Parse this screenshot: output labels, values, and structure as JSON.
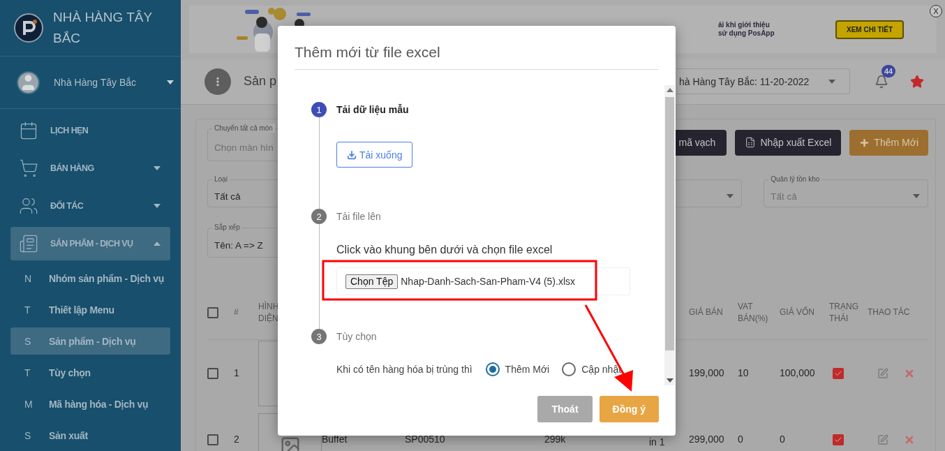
{
  "sidebar": {
    "brand": "NHÀ HÀNG TÂY BẮC",
    "user": "Nhà Hàng Tây Bắc",
    "items": [
      {
        "kind": "link",
        "label": "LỊCH HẸN",
        "selected": false
      },
      {
        "kind": "group",
        "label": "BÁN HÀNG",
        "selected": false,
        "expanded": false
      },
      {
        "kind": "group",
        "label": "ĐỐI TÁC",
        "selected": false,
        "expanded": false
      },
      {
        "kind": "group",
        "label": "SẢN PHẨM - DỊCH VỤ",
        "selected": true,
        "expanded": true,
        "children": [
          {
            "letter": "N",
            "label": "Nhóm sản phẩm - Dịch vụ",
            "selected": false
          },
          {
            "letter": "T",
            "label": "Thiết lập Menu",
            "selected": false
          },
          {
            "letter": "S",
            "label": "Sản phẩm - Dịch vụ",
            "selected": true
          },
          {
            "letter": "T",
            "label": "Tùy chọn",
            "selected": false
          },
          {
            "letter": "M",
            "label": "Mã hàng hóa - Dịch vụ",
            "selected": false
          },
          {
            "letter": "S",
            "label": "Sản xuất",
            "selected": false
          }
        ]
      }
    ]
  },
  "banner": {
    "lines": [
      "ải khi giới thiệu",
      "sử dụng PosApp"
    ],
    "button": "XEM CHI TIẾT",
    "close": "X"
  },
  "header": {
    "title": "Sản p",
    "store": "hà Hàng Tây Bắc: 11-20-2022",
    "notifications": "44"
  },
  "toolbar": {
    "buttons": [
      {
        "kind": "dark",
        "label": "mã vạch"
      },
      {
        "kind": "excel",
        "label": "Nhập xuất Excel"
      },
      {
        "kind": "add",
        "label": "Thêm Mới"
      }
    ]
  },
  "filters": {
    "move": {
      "label": "Chuyển tất cả món",
      "placeholder": "Chọn màn hìn"
    },
    "type": {
      "label": "Loại",
      "value": "Tất cả"
    },
    "stock": {
      "label": "Quản lý tồn kho",
      "placeholder": "Tất cả"
    },
    "sort": {
      "label": "Sắp xếp",
      "value": "Tên: A => Z"
    }
  },
  "table": {
    "header": {
      "checked": false,
      "number": "#",
      "image": "HÌNH DIỆN",
      "gia_ban": "GIÁ BÁN",
      "vat_ban": "VAT BÁN(%)",
      "gia_von": "GIÁ VỐN",
      "trang_thai": "TRẠNG THÁI",
      "thao_tac": "THAO TÁC"
    },
    "rows": [
      {
        "checked": false,
        "number": "1",
        "gia_ban": "199,000",
        "vat_ban": "10",
        "gia_von": "100,000",
        "trang_thai": true
      },
      {
        "checked": false,
        "number": "2",
        "column_4": "Buffet",
        "column_5": "SP00510",
        "column_6": "299k",
        "column_7": "in 1",
        "gia_ban": "299,000",
        "vat_ban": "0",
        "gia_von": "0",
        "trang_thai": true
      }
    ]
  },
  "modal": {
    "title": "Thêm mới từ file excel",
    "steps": [
      {
        "number": "1",
        "title": "Tải dữ liệu mẫu",
        "active": true,
        "kind": "download",
        "button": "Tải xuống"
      },
      {
        "number": "2",
        "title": "Tải file lên",
        "active": false,
        "kind": "upload",
        "hint": "Click vào khung bên dưới và chọn file excel",
        "choose": "Chọn Tệp",
        "file": "Nhap-Danh-Sach-San-Pham-V4 (5).xlsx"
      },
      {
        "number": "3",
        "title": "Tùy chọn",
        "active": false,
        "kind": "options",
        "question": "Khi có tên hàng hóa bị trùng thì",
        "options": [
          {
            "label": "Thêm Mới",
            "selected": true
          },
          {
            "label": "Cập nhật",
            "selected": false
          }
        ]
      }
    ],
    "buttons": [
      {
        "label": "Thoát",
        "disabled": true
      },
      {
        "label": "Đồng ý",
        "disabled": false
      }
    ]
  }
}
